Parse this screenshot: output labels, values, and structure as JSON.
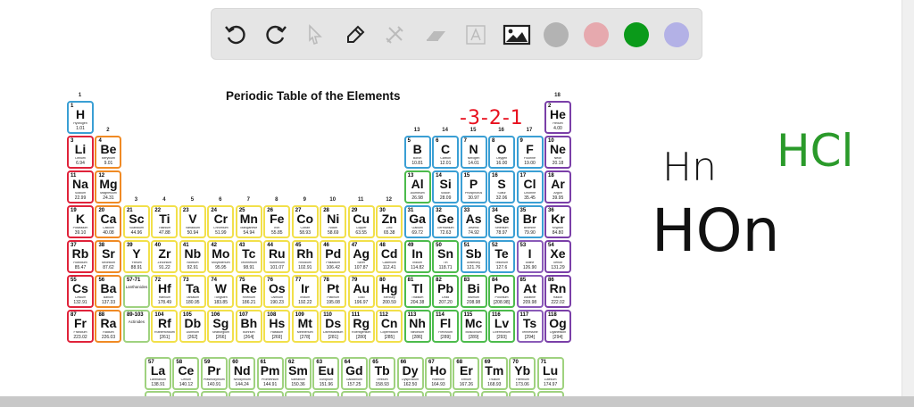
{
  "toolbar": {
    "tools": [
      "undo",
      "redo",
      "select",
      "pen",
      "tools",
      "eraser",
      "text",
      "image"
    ],
    "colors": [
      "#b3b3b3",
      "#e6a9ae",
      "#0b9a1a",
      "#b3b1e6"
    ]
  },
  "table": {
    "title": "Periodic Table of the Elements",
    "groups": [
      "1",
      "2",
      "3",
      "4",
      "5",
      "6",
      "7",
      "8",
      "9",
      "10",
      "11",
      "12",
      "13",
      "14",
      "15",
      "16",
      "17",
      "18"
    ],
    "lanthanides_label": "57-71",
    "lanthanides_name": "Lanthanides",
    "actinides_label": "89-103",
    "actinides_name": "Actinides",
    "category_colors": {
      "alkali": "#e0233a",
      "alkaline": "#f08a24",
      "transition": "#f2e04a",
      "nonmetal": "#3a9fd4",
      "post": "#4cbb4c",
      "halogen": "#3a9fd4",
      "noble": "#7a3fa8",
      "lan": "#9fd27f",
      "hyd": "#3a9fd4",
      "heavyhal": "#8a5ab8"
    },
    "elements": [
      [
        1,
        "H",
        "Hydrogen",
        "1.01",
        "hyd"
      ],
      [
        2,
        "He",
        "Helium",
        "4.00",
        "noble"
      ],
      [
        3,
        "Li",
        "Lithium",
        "6.94",
        "alkali"
      ],
      [
        4,
        "Be",
        "Beryllium",
        "9.01",
        "alkaline"
      ],
      [
        5,
        "B",
        "Boron",
        "10.81",
        "nonmetal"
      ],
      [
        6,
        "C",
        "Carbon",
        "12.01",
        "nonmetal"
      ],
      [
        7,
        "N",
        "Nitrogen",
        "14.01",
        "nonmetal"
      ],
      [
        8,
        "O",
        "Oxygen",
        "16.00",
        "nonmetal"
      ],
      [
        9,
        "F",
        "Fluorine",
        "19.00",
        "halogen"
      ],
      [
        10,
        "Ne",
        "Neon",
        "20.18",
        "noble"
      ],
      [
        11,
        "Na",
        "Sodium",
        "22.99",
        "alkali"
      ],
      [
        12,
        "Mg",
        "Magnesium",
        "24.31",
        "alkaline"
      ],
      [
        13,
        "Al",
        "Aluminum",
        "26.98",
        "post"
      ],
      [
        14,
        "Si",
        "Silicon",
        "28.09",
        "nonmetal"
      ],
      [
        15,
        "P",
        "Phosphorus",
        "30.97",
        "nonmetal"
      ],
      [
        16,
        "S",
        "Sulfur",
        "32.06",
        "nonmetal"
      ],
      [
        17,
        "Cl",
        "Chlorine",
        "35.45",
        "halogen"
      ],
      [
        18,
        "Ar",
        "Argon",
        "39.95",
        "noble"
      ],
      [
        19,
        "K",
        "Potassium",
        "39.10",
        "alkali"
      ],
      [
        20,
        "Ca",
        "Calcium",
        "40.08",
        "alkaline"
      ],
      [
        21,
        "Sc",
        "Scandium",
        "44.96",
        "transition"
      ],
      [
        22,
        "Ti",
        "Titanium",
        "47.88",
        "transition"
      ],
      [
        23,
        "V",
        "Vanadium",
        "50.94",
        "transition"
      ],
      [
        24,
        "Cr",
        "Chromium",
        "51.99",
        "transition"
      ],
      [
        25,
        "Mn",
        "Manganese",
        "54.94",
        "transition"
      ],
      [
        26,
        "Fe",
        "Iron",
        "55.85",
        "transition"
      ],
      [
        27,
        "Co",
        "Cobalt",
        "58.93",
        "transition"
      ],
      [
        28,
        "Ni",
        "Nickel",
        "58.69",
        "transition"
      ],
      [
        29,
        "Cu",
        "Copper",
        "63.55",
        "transition"
      ],
      [
        30,
        "Zn",
        "Zinc",
        "65.38",
        "transition"
      ],
      [
        31,
        "Ga",
        "Gallium",
        "69.72",
        "nonmetal"
      ],
      [
        32,
        "Ge",
        "Germanium",
        "72.63",
        "nonmetal"
      ],
      [
        33,
        "As",
        "Arsenic",
        "74.92",
        "nonmetal"
      ],
      [
        34,
        "Se",
        "Selenium",
        "78.97",
        "nonmetal"
      ],
      [
        35,
        "Br",
        "Bromine",
        "79.90",
        "halogen"
      ],
      [
        36,
        "Kr",
        "Krypton",
        "84.80",
        "noble"
      ],
      [
        37,
        "Rb",
        "Rubidium",
        "85.47",
        "alkali"
      ],
      [
        38,
        "Sr",
        "Strontium",
        "87.62",
        "alkaline"
      ],
      [
        39,
        "Y",
        "Yttrium",
        "88.91",
        "transition"
      ],
      [
        40,
        "Zr",
        "Zirconium",
        "91.22",
        "transition"
      ],
      [
        41,
        "Nb",
        "Niobium",
        "92.91",
        "transition"
      ],
      [
        42,
        "Mo",
        "Molybdenum",
        "95.95",
        "transition"
      ],
      [
        43,
        "Tc",
        "Technetium",
        "98.91",
        "transition"
      ],
      [
        44,
        "Ru",
        "Ruthenium",
        "101.07",
        "transition"
      ],
      [
        45,
        "Rh",
        "Rhodium",
        "102.91",
        "transition"
      ],
      [
        46,
        "Pd",
        "Palladium",
        "106.42",
        "transition"
      ],
      [
        47,
        "Ag",
        "Silver",
        "107.87",
        "transition"
      ],
      [
        48,
        "Cd",
        "Cadmium",
        "112.41",
        "transition"
      ],
      [
        49,
        "In",
        "Indium",
        "114.82",
        "post"
      ],
      [
        50,
        "Sn",
        "Tin",
        "118.71",
        "post"
      ],
      [
        51,
        "Sb",
        "Antimony",
        "121.76",
        "nonmetal"
      ],
      [
        52,
        "Te",
        "Tellurium",
        "127.6",
        "nonmetal"
      ],
      [
        53,
        "I",
        "Iodine",
        "126.90",
        "heavyhal"
      ],
      [
        54,
        "Xe",
        "Xenon",
        "131.29",
        "noble"
      ],
      [
        55,
        "Cs",
        "Cesium",
        "132.91",
        "alkali"
      ],
      [
        56,
        "Ba",
        "Barium",
        "137.33",
        "alkaline"
      ],
      [
        72,
        "Hf",
        "Hafnium",
        "178.49",
        "transition"
      ],
      [
        73,
        "Ta",
        "Tantalum",
        "180.95",
        "transition"
      ],
      [
        74,
        "W",
        "Tungsten",
        "183.85",
        "transition"
      ],
      [
        75,
        "Re",
        "Rhenium",
        "186.21",
        "transition"
      ],
      [
        76,
        "Os",
        "Osmium",
        "190.23",
        "transition"
      ],
      [
        77,
        "Ir",
        "Iridium",
        "192.22",
        "transition"
      ],
      [
        78,
        "Pt",
        "Platinum",
        "195.08",
        "transition"
      ],
      [
        79,
        "Au",
        "Gold",
        "196.97",
        "transition"
      ],
      [
        80,
        "Hg",
        "Mercury",
        "200.59",
        "transition"
      ],
      [
        81,
        "Tl",
        "Thallium",
        "204.38",
        "post"
      ],
      [
        82,
        "Pb",
        "Lead",
        "207.20",
        "post"
      ],
      [
        83,
        "Bi",
        "Bismuth",
        "208.98",
        "post"
      ],
      [
        84,
        "Po",
        "Polonium",
        "[208.98]",
        "post"
      ],
      [
        85,
        "At",
        "Astatine",
        "209.98",
        "heavyhal"
      ],
      [
        86,
        "Rn",
        "Radon",
        "222.02",
        "noble"
      ],
      [
        87,
        "Fr",
        "Francium",
        "223.02",
        "alkali"
      ],
      [
        88,
        "Ra",
        "Radium",
        "226.03",
        "alkaline"
      ],
      [
        104,
        "Rf",
        "Rutherfordium",
        "[261]",
        "transition"
      ],
      [
        105,
        "Db",
        "Dubnium",
        "[262]",
        "transition"
      ],
      [
        106,
        "Sg",
        "Seaborgium",
        "[266]",
        "transition"
      ],
      [
        107,
        "Bh",
        "Bohrium",
        "[264]",
        "transition"
      ],
      [
        108,
        "Hs",
        "Hassium",
        "[269]",
        "transition"
      ],
      [
        109,
        "Mt",
        "Meitnerium",
        "[278]",
        "transition"
      ],
      [
        110,
        "Ds",
        "Darmstadtium",
        "[281]",
        "transition"
      ],
      [
        111,
        "Rg",
        "Roentgenium",
        "[280]",
        "transition"
      ],
      [
        112,
        "Cn",
        "Copernicium",
        "[285]",
        "transition"
      ],
      [
        113,
        "Nh",
        "Nihonium",
        "[286]",
        "post"
      ],
      [
        114,
        "Fl",
        "Flerovium",
        "[289]",
        "post"
      ],
      [
        115,
        "Mc",
        "Moscovium",
        "[289]",
        "post"
      ],
      [
        116,
        "Lv",
        "Livermorium",
        "[293]",
        "post"
      ],
      [
        117,
        "Ts",
        "Tennessine",
        "[294]",
        "heavyhal"
      ],
      [
        118,
        "Og",
        "Oganesson",
        "[294]",
        "noble"
      ],
      [
        57,
        "La",
        "Lanthanum",
        "138.91",
        "lan"
      ],
      [
        58,
        "Ce",
        "Cerium",
        "140.12",
        "lan"
      ],
      [
        59,
        "Pr",
        "Praseodymium",
        "140.91",
        "lan"
      ],
      [
        60,
        "Nd",
        "Neodymium",
        "144.24",
        "lan"
      ],
      [
        61,
        "Pm",
        "Promethium",
        "144.91",
        "lan"
      ],
      [
        62,
        "Sm",
        "Samarium",
        "150.36",
        "lan"
      ],
      [
        63,
        "Eu",
        "Europium",
        "151.96",
        "lan"
      ],
      [
        64,
        "Gd",
        "Gadolinium",
        "157.25",
        "lan"
      ],
      [
        65,
        "Tb",
        "Terbium",
        "158.93",
        "lan"
      ],
      [
        66,
        "Dy",
        "Dysprosium",
        "162.50",
        "lan"
      ],
      [
        67,
        "Ho",
        "Holmium",
        "164.93",
        "lan"
      ],
      [
        68,
        "Er",
        "Erbium",
        "167.26",
        "lan"
      ],
      [
        69,
        "Tm",
        "Thulium",
        "168.93",
        "lan"
      ],
      [
        70,
        "Yb",
        "Ytterbium",
        "173.06",
        "lan"
      ],
      [
        71,
        "Lu",
        "Lutetium",
        "174.97",
        "lan"
      ]
    ]
  },
  "annotations": {
    "charges": "-3-2-1",
    "charge_color": "#e8101e",
    "note1": "Hn",
    "note2": "HOn",
    "note3": "HCl",
    "note3_color": "#2a9a2a"
  }
}
